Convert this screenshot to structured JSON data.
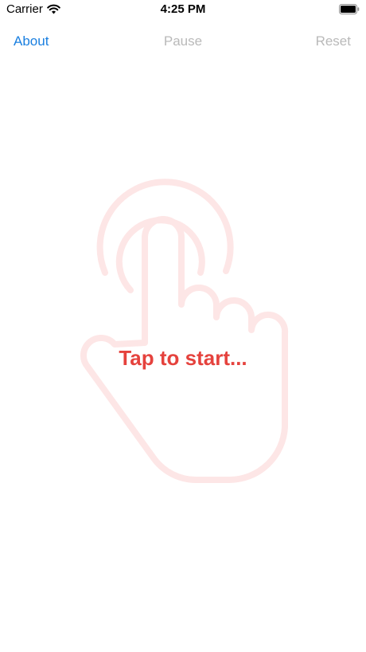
{
  "status_bar": {
    "carrier": "Carrier",
    "time": "4:25 PM",
    "wifi_icon": "wifi-icon",
    "battery_icon": "battery-icon"
  },
  "nav": {
    "about_label": "About",
    "pause_label": "Pause",
    "reset_label": "Reset"
  },
  "main": {
    "tap_label": "Tap to start...",
    "hand_icon": "tap-hand-icon"
  },
  "colors": {
    "accent_blue": "#1a7fe0",
    "disabled_gray": "#b9b9b9",
    "prompt_red": "#e5423d",
    "hand_outline": "#fde6e6"
  }
}
